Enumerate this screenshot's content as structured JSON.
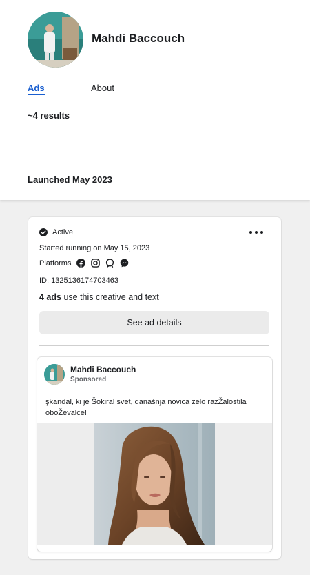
{
  "profile": {
    "name": "Mahdi Baccouch"
  },
  "tabs": {
    "ads": "Ads",
    "about": "About"
  },
  "results": "~4 results",
  "section_heading": "Launched May 2023",
  "ad_card": {
    "status": "Active",
    "started": "Started running on May 15, 2023",
    "platforms_label": "Platforms",
    "platforms": [
      "facebook-icon",
      "instagram-icon",
      "audience-network-icon",
      "messenger-icon"
    ],
    "id_text": "ID: 1325136174703463",
    "uses_count": "4 ads",
    "uses_text": " use this creative and text",
    "details_button": "See ad details",
    "preview": {
      "page_name": "Mahdi Baccouch",
      "sponsored": "Sponsored",
      "body": "şkandal, ki je Šokiral svet, današnja novica zelo razŽalostila oboŽevalce!"
    }
  },
  "colors": {
    "accent": "#1a5fd0",
    "background": "#f0f0f0",
    "card": "#ffffff"
  }
}
